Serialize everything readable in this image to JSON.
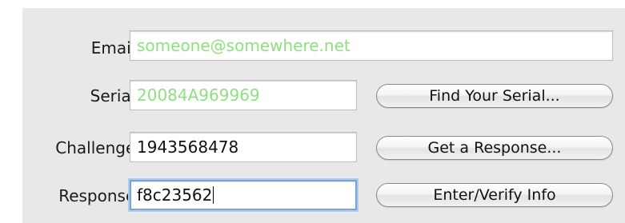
{
  "form": {
    "email": {
      "label": "Email:",
      "value": "someone@somewhere.net"
    },
    "serial": {
      "label": "Serial:",
      "value": "20084A969969",
      "button_label": "Find Your Serial..."
    },
    "challenge": {
      "label": "Challenge:",
      "value": "1943568478",
      "button_label": "Get a Response..."
    },
    "response": {
      "label": "Response:",
      "value": "f8c23562",
      "button_label": "Enter/Verify Info"
    }
  },
  "colors": {
    "panel_bg": "#e8e8e8",
    "placeholder_green": "#8fe07e",
    "focus_ring": "#7ba3d6"
  }
}
